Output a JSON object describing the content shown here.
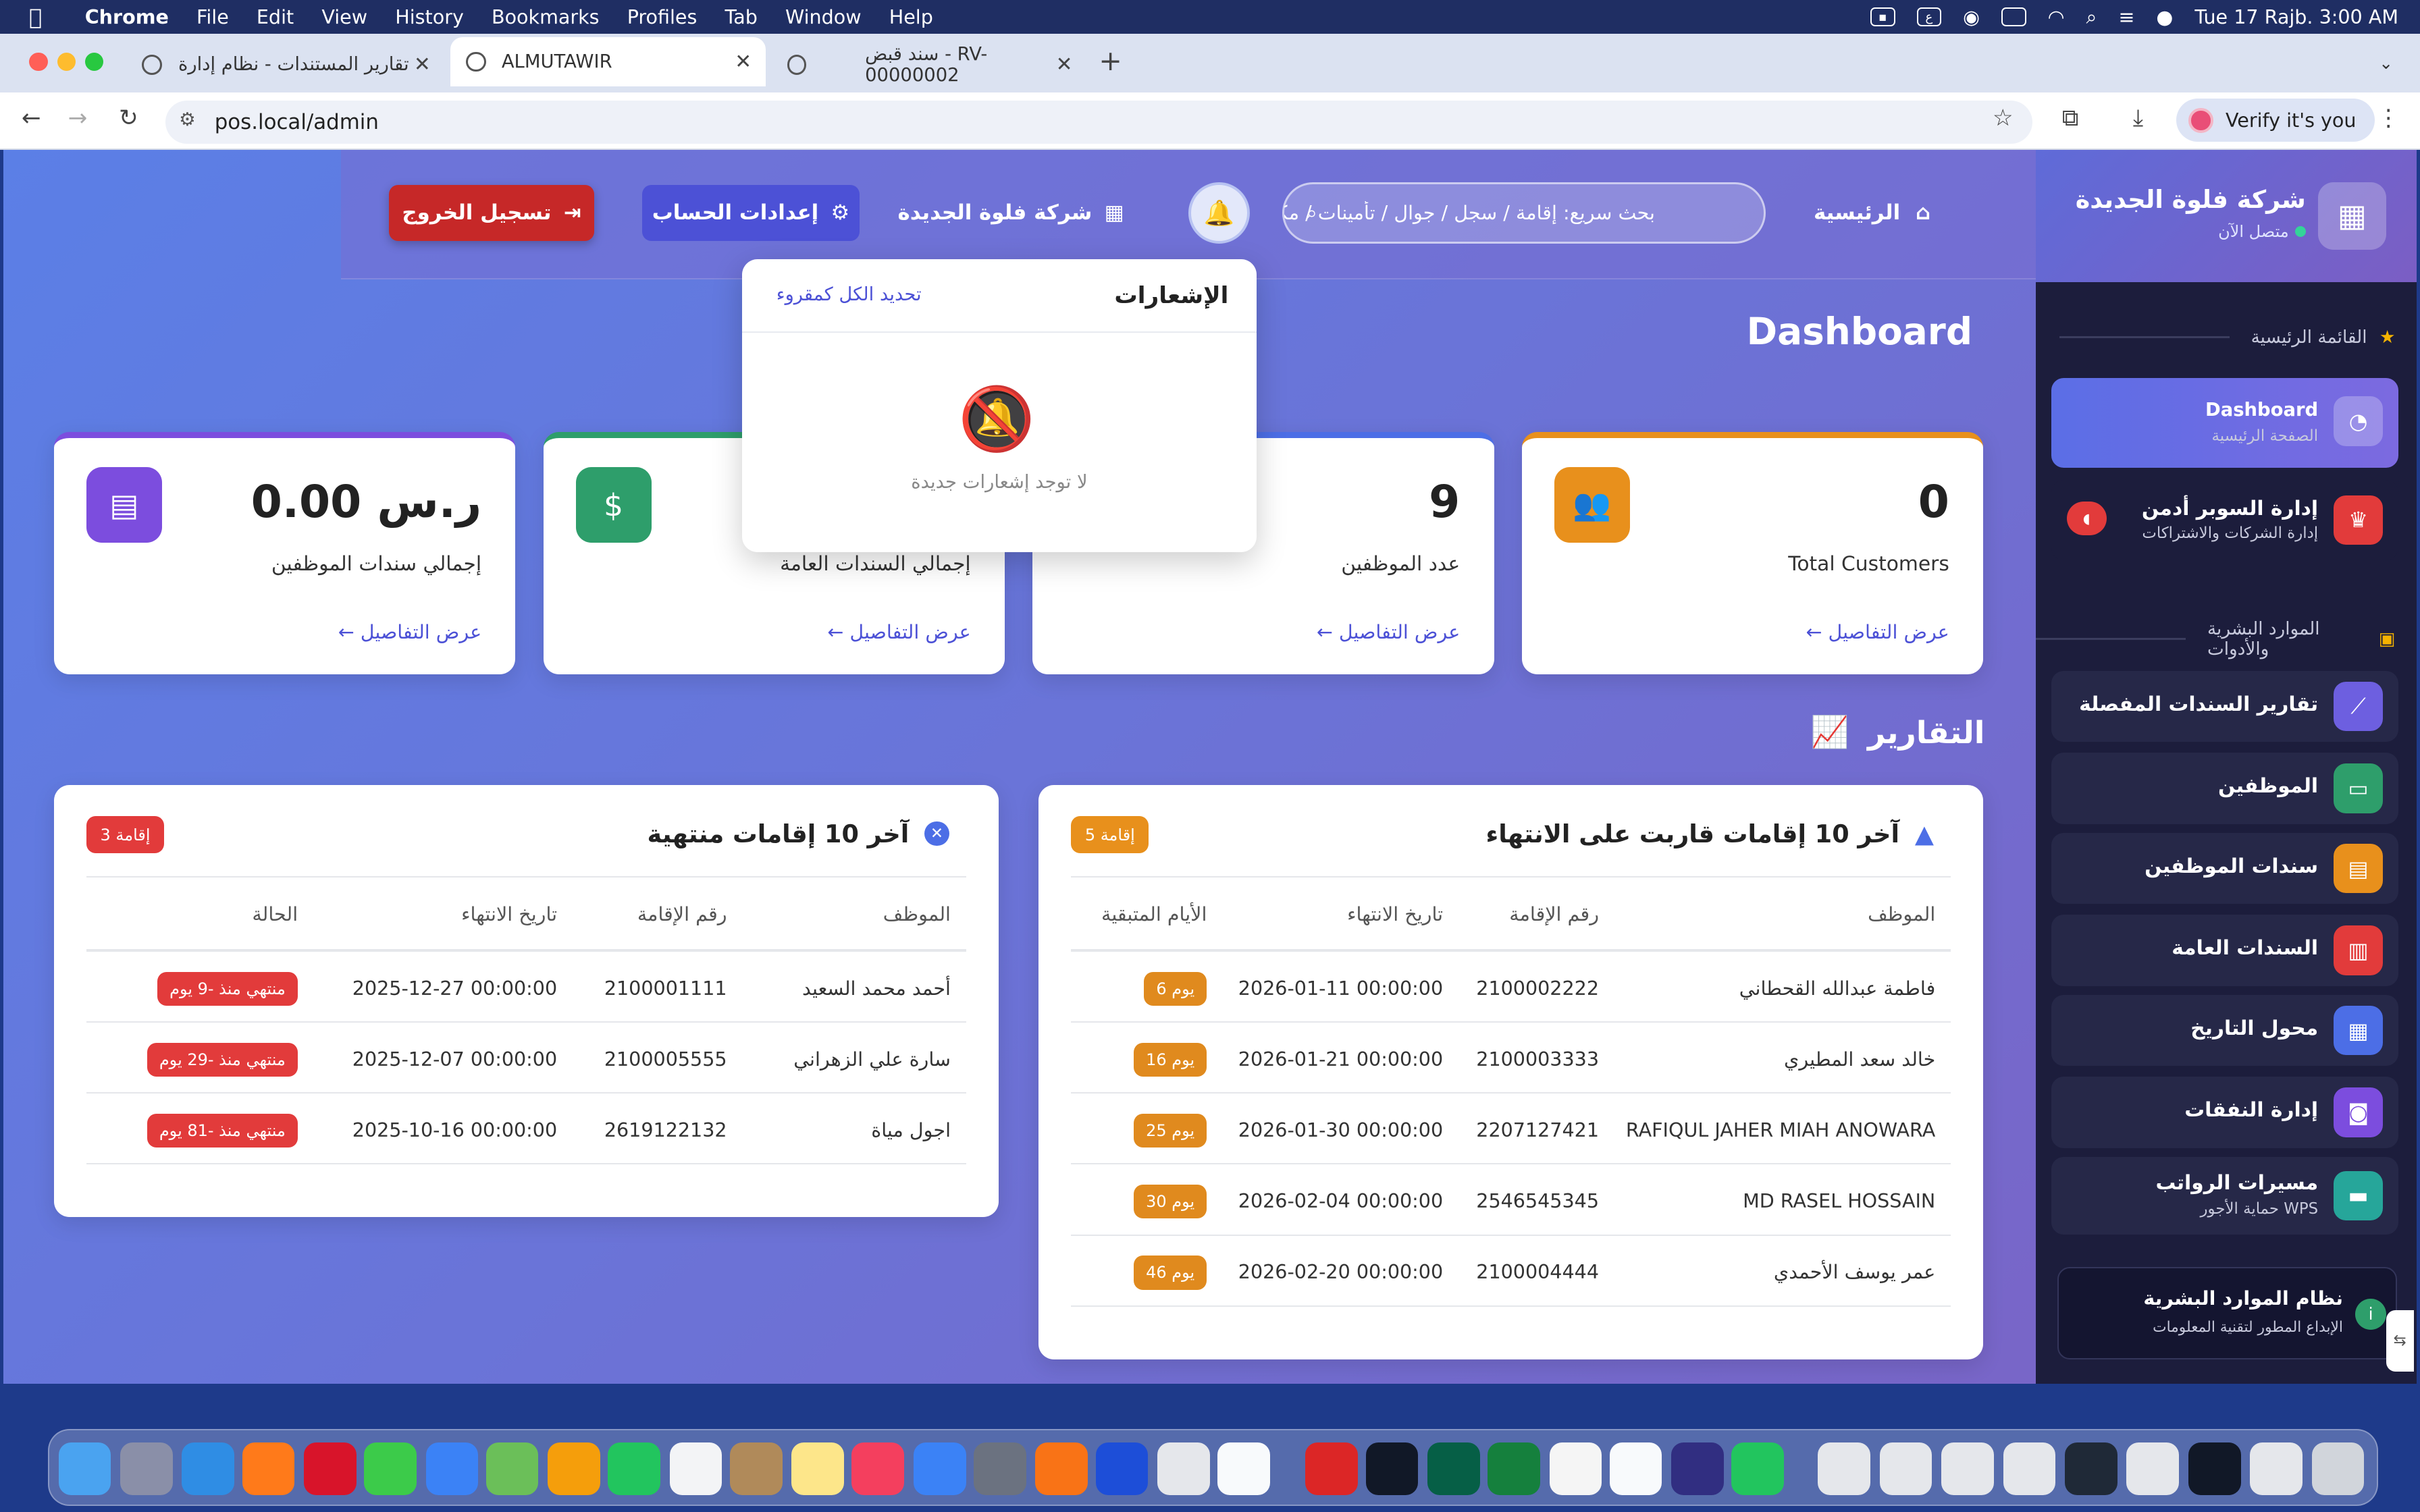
{
  "menubar": {
    "app": "Chrome",
    "items": [
      "File",
      "Edit",
      "View",
      "History",
      "Bookmarks",
      "Profiles",
      "Tab",
      "Window",
      "Help"
    ],
    "clock": "Tue 17 Rajb.  3:00 AM"
  },
  "browser": {
    "tabs": [
      {
        "title": "تقارير المستندات - نظام إدارة المو"
      },
      {
        "title": "ALMUTAWIR"
      },
      {
        "title": "سند قبض - RV-00000002"
      }
    ],
    "url": "pos.local/admin",
    "verify": "Verify it's you"
  },
  "topnav": {
    "logout": "تسجيل الخروج",
    "account": "إعدادات الحساب",
    "company": "شركة فلوة الجديدة",
    "search_placeholder": "بحث سريع: إقامة / سجل / جوال / تأمينات / مكتب",
    "home": "الرئيسية"
  },
  "page": {
    "title": "Dashboard",
    "reports_title": "التقارير"
  },
  "stats": [
    {
      "value": "0.00 ر.س",
      "label": "إجمالي سندات الموظفين",
      "link": "عرض التفاصيل",
      "icon": "receipt-icon",
      "color": "#7c4dde",
      "accent": "#7c4dde"
    },
    {
      "value": "",
      "label": "إجمالي السندات العامة",
      "link": "عرض التفاصيل",
      "icon": "money-icon",
      "color": "#2e9e6b",
      "accent": "#2e9e6b"
    },
    {
      "value": "9",
      "label": "عدد الموظفين",
      "link": "عرض التفاصيل",
      "icon": "id-icon",
      "color": "#4c6ee6",
      "accent": "#4c6ee6"
    },
    {
      "value": "0",
      "label": "Total Customers",
      "link": "عرض التفاصيل",
      "icon": "users-icon",
      "color": "#e8901c",
      "accent": "#e8901c"
    }
  ],
  "expired": {
    "title": "آخر 10 إقامات منتهية",
    "badge": "3 إقامة",
    "headers": [
      "الموظف",
      "رقم الإقامة",
      "تاريخ الانتهاء",
      "الحالة"
    ],
    "rows": [
      {
        "name": "أحمد محمد السعيد",
        "iqama": "2100001111",
        "date": "2025-12-27 00:00:00",
        "status": "منتهي منذ -9 يوم"
      },
      {
        "name": "سارة علي الزهراني",
        "iqama": "2100005555",
        "date": "2025-12-07 00:00:00",
        "status": "منتهي منذ -29 يوم"
      },
      {
        "name": "اجول مياة",
        "iqama": "2619122132",
        "date": "2025-10-16 00:00:00",
        "status": "منتهي منذ -81 يوم"
      }
    ]
  },
  "expiring": {
    "title": "آخر 10 إقامات قاربت على الانتهاء",
    "badge": "5 إقامة",
    "headers": [
      "الموظف",
      "رقم الإقامة",
      "تاريخ الانتهاء",
      "الأيام المتبقية"
    ],
    "rows": [
      {
        "name": "فاطمة عبدالله القحطاني",
        "iqama": "2100002222",
        "date": "2026-01-11 00:00:00",
        "days": "6 يوم"
      },
      {
        "name": "خالد سعد المطيري",
        "iqama": "2100003333",
        "date": "2026-01-21 00:00:00",
        "days": "16 يوم"
      },
      {
        "name": "RAFIQUL JAHER MIAH ANOWARA",
        "iqama": "2207127421",
        "date": "2026-01-30 00:00:00",
        "days": "25 يوم"
      },
      {
        "name": "MD RASEL HOSSAIN",
        "iqama": "2546545345",
        "date": "2026-02-04 00:00:00",
        "days": "30 يوم"
      },
      {
        "name": "عمر يوسف الأحمدي",
        "iqama": "2100004444",
        "date": "2026-02-20 00:00:00",
        "days": "46 يوم"
      }
    ]
  },
  "notifications": {
    "title": "الإشعارات",
    "mark_all": "تحديد الكل كمقروء",
    "empty": "لا توجد إشعارات جديدة"
  },
  "sidebar": {
    "company": "شركة فلوة الجديدة",
    "status": "متصل الآن",
    "section_main": "القائمة الرئيسية",
    "section_hr": "الموارد البشرية والأدوات",
    "items": [
      {
        "label": "Dashboard",
        "sub": "الصفحة الرئيسية",
        "color": "rgba(255,255,255,.25)"
      },
      {
        "label": "إدارة السوبر أدمن",
        "sub": "إدارة الشركات والاشتراكات",
        "color": "#e23b3b"
      },
      {
        "label": "تقارير السندات المفصلة",
        "color": "#6d5fe0"
      },
      {
        "label": "الموظفين",
        "color": "#2e9e6b"
      },
      {
        "label": "سندات الموظفين",
        "color": "#e8901c"
      },
      {
        "label": "السندات العامة",
        "color": "#e23b3b"
      },
      {
        "label": "محول التاريخ",
        "color": "#4c6ee6"
      },
      {
        "label": "إدارة النفقات",
        "color": "#7c4dde"
      },
      {
        "label": "مسيرات الرواتب",
        "sub": "حماية الأجور WPS",
        "color": "#26a69a"
      }
    ],
    "footer_title": "نظام الموارد البشرية",
    "footer_sub": "الإبداع المطور لتقنية المعلومات"
  }
}
